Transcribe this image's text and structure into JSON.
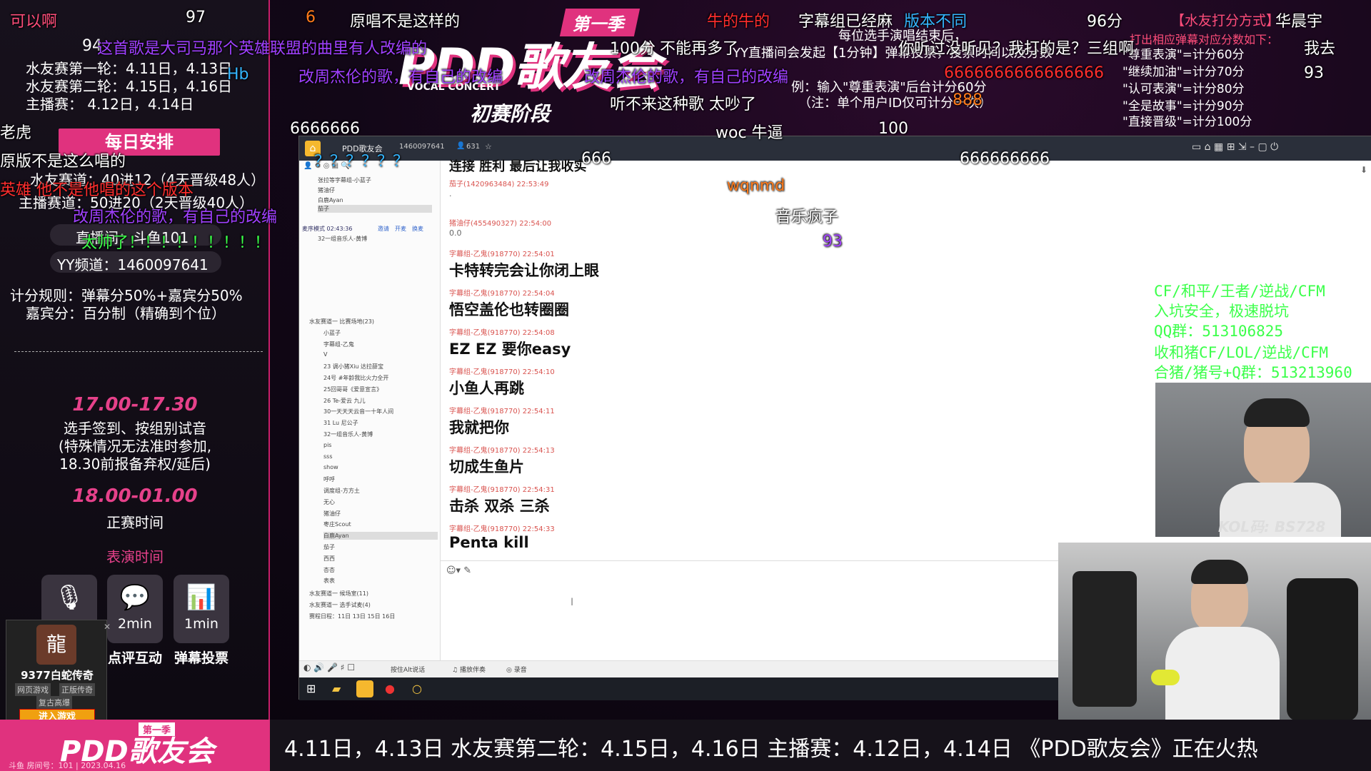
{
  "left_panel": {
    "top_num": "94",
    "round1": "水友赛第一轮：4.11日，4.13日",
    "round2": "水友赛第二轮：4.15日，4.16日",
    "main": "主播赛：      4.12日，4.14日",
    "schedule_btn": "每日安排",
    "track1": "水友赛道：40进12（4天晋级48人）",
    "track2": "主播赛道：50进20（2天晋级40人）",
    "live_room": "直播间：斗鱼101",
    "yy": "YY频道：1460097641",
    "rule1": "计分规则：弹幕分50%+嘉宾分50%",
    "rule2": "嘉宾分：百分制（精确到个位）",
    "time1": "17.00-17.30",
    "desc1": [
      "选手签到、按组别试音",
      "(特殊情况无法准时参加,",
      "18.30前报备弃权/延后)"
    ],
    "time2": "18.00-01.00",
    "desc2": "正赛时间",
    "perf_time": "表演时间",
    "tiles": [
      {
        "icon": "microphone-icon",
        "value": "",
        "caption": ""
      },
      {
        "icon": "comment-icon",
        "value": "2min",
        "caption": "点评互动"
      },
      {
        "icon": "vote-icon",
        "value": "1min",
        "caption": "弹幕投票"
      }
    ],
    "game_ad": {
      "title": "9377白蛇传奇",
      "tag1": "网页游戏",
      "tag2": "正版传奇",
      "tag3": "复古高爆",
      "button": "进入游戏"
    }
  },
  "banner": {
    "season": "第一季",
    "title": "PDD歌友会",
    "sub": "VOCAL CONCERT",
    "stage": "初赛阶段"
  },
  "score_panel": {
    "header": "【水友打分方式】",
    "lines": [
      "打出相应弹幕对应分数如下：",
      "\"尊重表演\"=计分60分",
      "\"继续加油\"=计分70分",
      "\"认可表演\"=计分80分",
      "\"全是故事\"=计分90分",
      "\"直接晋级\"=计分100分"
    ],
    "note1": "每位选手演唱结束后，",
    "note2": "YY直播间会发起【1分钟】弹幕投票，投票时间以及分数",
    "note3": "例：输入\"尊重表演\"后台计分60分",
    "note4": "（注：单个用户ID仅可计分一次）"
  },
  "danmaku": [
    {
      "t": "可以啊",
      "c": "pk"
    },
    {
      "t": "97",
      "c": "w"
    },
    {
      "t": "6",
      "c": "og"
    },
    {
      "t": "原唱不是这样的",
      "c": "w"
    },
    {
      "t": "牛的牛的",
      "c": "rd"
    },
    {
      "t": "字幕组已经麻",
      "c": "w"
    },
    {
      "t": "版本不同",
      "c": "cy"
    },
    {
      "t": "96分",
      "c": "w"
    },
    {
      "t": "华晨宇",
      "c": "w"
    },
    {
      "t": "这首歌是大司马那个英雄联盟的曲里有人改编的",
      "c": "pu"
    },
    {
      "t": "100分",
      "c": "w"
    },
    {
      "t": "不能再多了",
      "c": "w"
    },
    {
      "t": "你听过没听见？我打的是？三组啊",
      "c": "w"
    },
    {
      "t": "我去",
      "c": "w"
    },
    {
      "t": "改周杰伦的歌，有自己的改编",
      "c": "pu"
    },
    {
      "t": "改周杰伦的歌，有自己的改编",
      "c": "pu"
    },
    {
      "t": "6666666666666666",
      "c": "rd"
    },
    {
      "t": "93",
      "c": "w"
    },
    {
      "t": "听不来这种歌 太吵了",
      "c": "w"
    },
    {
      "t": "888",
      "c": "og"
    },
    {
      "t": "老虎",
      "c": "w"
    },
    {
      "t": "6666666",
      "c": "w"
    },
    {
      "t": "woc 牛逼",
      "c": "w"
    },
    {
      "t": "100",
      "c": "w"
    },
    {
      "t": "666",
      "c": "w"
    },
    {
      "t": "666666666",
      "c": "w"
    },
    {
      "t": "原版不是这么唱的",
      "c": "w"
    },
    {
      "t": "英雄 他不是他唱的这个版本",
      "c": "rd"
    },
    {
      "t": "改周杰伦的歌，有自己的改编",
      "c": "pu"
    },
    {
      "t": "太帅了！！！！！！！！！",
      "c": "gr"
    },
    {
      "t": "wqnmd",
      "c": "og"
    },
    {
      "t": "音乐疯子",
      "c": "w"
    },
    {
      "t": "93",
      "c": "pu"
    },
    {
      "t": "Hb",
      "c": "cy"
    },
    {
      "t": "？？？？？？",
      "c": "cy"
    }
  ],
  "app": {
    "title": "PDD歌友会",
    "channel_id": "1460097641",
    "users": "631",
    "sidebar_top": [
      "张拉等字幕组-小蓝子",
      "猪油仔",
      "白鹿Ayan",
      "茄子"
    ],
    "mode": "麦序模式",
    "mode_time": "02:43:36",
    "tab1": "邀请",
    "tab2": "开麦",
    "tab3": "换麦",
    "sidebar_sel": "32一组音乐人-黄博",
    "tree": [
      "水友赛道一 比赛场地(23)",
      "小蓝子",
      "字幕组-乙鬼",
      "V",
      "23 调小猪Xiu 达拉薛宝",
      "24号 #年龄我比火力全开",
      "25回哥哥《爱意宣言》",
      "26 Te-爱云 九儿",
      "30一天天天云音一十年人间",
      "31 Lu 尼公子",
      "32一组音乐人-黄博",
      "pis",
      "sss",
      "show",
      "呼呼",
      "调度组-方方土",
      "无心",
      "猪油仔",
      "枣庄Scout",
      "白鹿Ayan",
      "茄子",
      "西西",
      "杏杏",
      "表表",
      "水友赛道一 候场室(11)",
      "水友赛道一 选手试麦(4)",
      "赛程日程：11日 13日 15日 16日"
    ],
    "messages": [
      {
        "meta": "茄子(1420963484)  22:53:49",
        "text": "."
      },
      {
        "meta": "猪油仔(455490327)  22:54:00",
        "text": "0.0"
      },
      {
        "meta": "字幕组-乙鬼(918770)  22:54:01",
        "text": "卡特转完会让你闭上眼"
      },
      {
        "meta": "字幕组-乙鬼(918770)  22:54:04",
        "text": "悟空盖伦也转圈圈"
      },
      {
        "meta": "字幕组-乙鬼(918770)  22:54:08",
        "text": "EZ EZ 要你easy"
      },
      {
        "meta": "字幕组-乙鬼(918770)  22:54:10",
        "text": "小鱼人再跳"
      },
      {
        "meta": "字幕组-乙鬼(918770)  22:54:11",
        "text": "我就把你"
      },
      {
        "meta": "字幕组-乙鬼(918770)  22:54:13",
        "text": "切成生鱼片"
      },
      {
        "meta": "字幕组-乙鬼(918770)  22:54:31",
        "text": "击杀 双杀 三杀"
      },
      {
        "meta": "字幕组-乙鬼(918770)  22:54:33",
        "text": "Penta kill"
      }
    ],
    "top_partial": "连接 胜利 最后让我收实",
    "bottom_items": [
      "按住Alt说话",
      "播放伴奏",
      "录音"
    ]
  },
  "right_ad": [
    "CF/和平/王者/逆战/CFM",
    "入坑安全，极速脱坑",
    "QQ群：513106825",
    "收和猪CF/LOL/逆战/CFM",
    "合猪/猪号+Q群：513213960"
  ],
  "kol": "KOL码: BS728",
  "ticker": "4.11日，4.13日  水友赛第二轮：4.15日，4.16日 主播赛：4.12日，4.14日      《PDD歌友会》正在火热",
  "footer_logo": "PDD歌友会",
  "footer_season": "第一季",
  "footer_small": "斗鱼 房间号：101 | 2023.04.16"
}
